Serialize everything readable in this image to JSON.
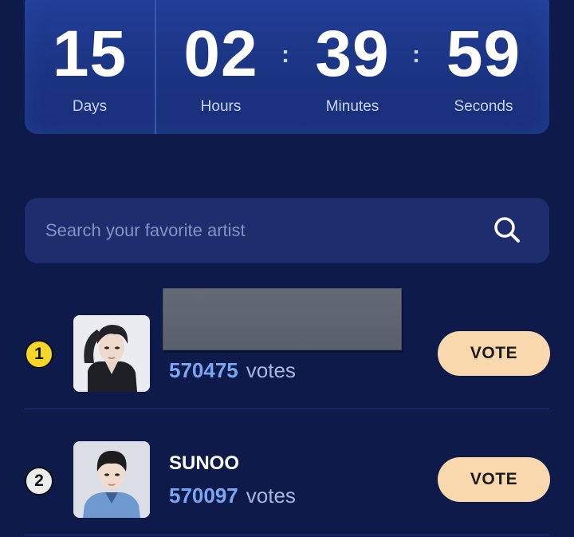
{
  "countdown": {
    "days": {
      "value": "15",
      "label": "Days"
    },
    "hours": {
      "value": "02",
      "label": "Hours"
    },
    "minutes": {
      "value": "39",
      "label": "Minutes"
    },
    "seconds": {
      "value": "59",
      "label": "Seconds"
    },
    "separator": ":"
  },
  "search": {
    "placeholder": "Search your favorite artist",
    "icon": "search-icon"
  },
  "ranking": [
    {
      "rank": "1",
      "name": "",
      "votes": "570475",
      "votes_unit": "votes",
      "button": "VOTE",
      "badge_color": "#f7d62a"
    },
    {
      "rank": "2",
      "name": "SUNOO",
      "votes": "570097",
      "votes_unit": "votes",
      "button": "VOTE",
      "badge_color": "#ededed"
    }
  ],
  "colors": {
    "background": "#0e1b4a",
    "panel": "#1f3a8f",
    "search_bg": "#1d2d6e",
    "vote_button": "#f9d8ae",
    "vote_count": "#7aa7f3"
  }
}
